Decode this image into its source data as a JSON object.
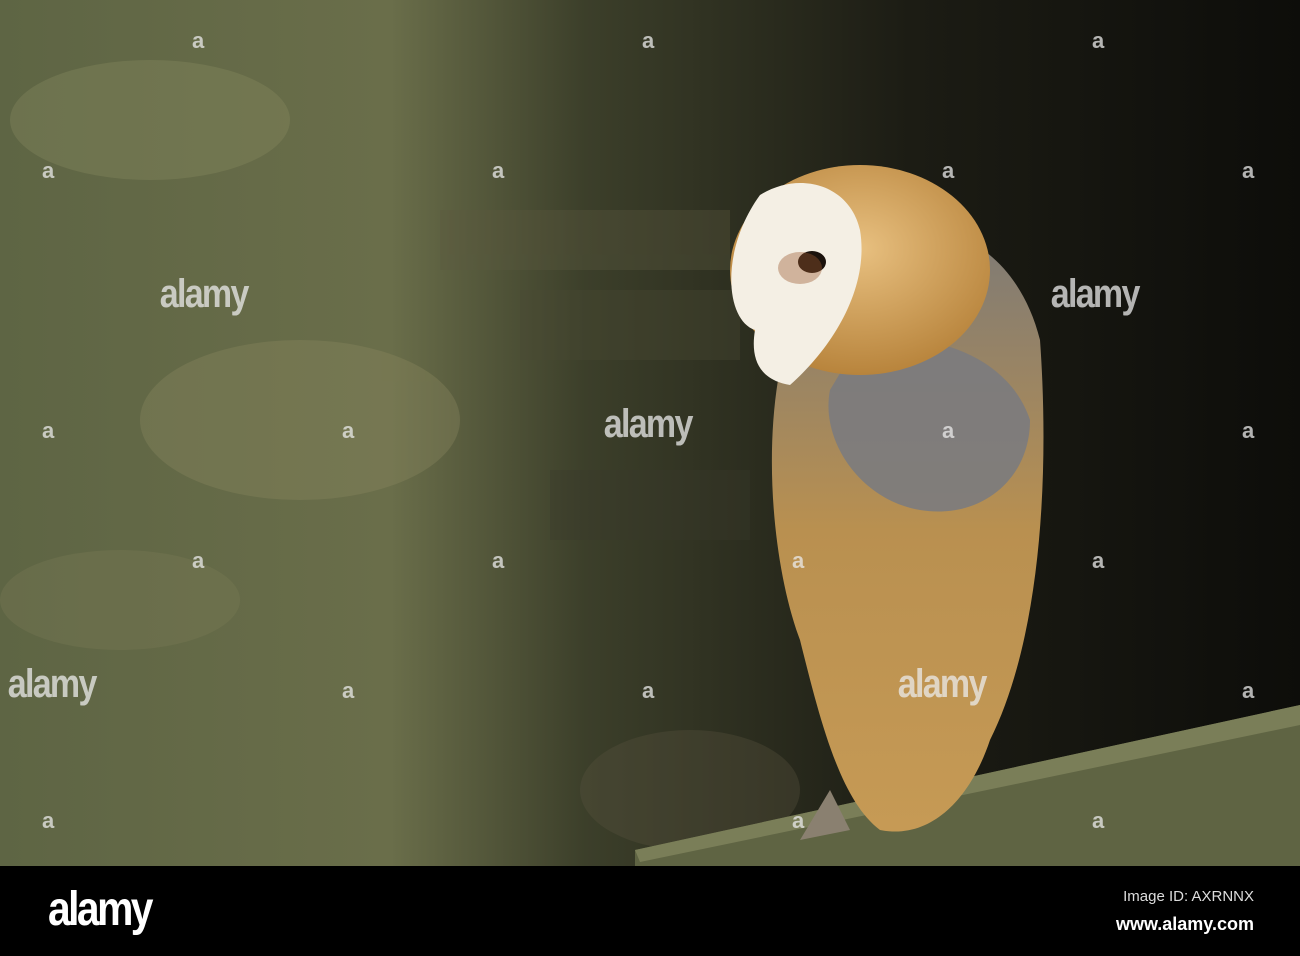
{
  "watermark": {
    "brand": "alamy",
    "small_mark": "a"
  },
  "footer": {
    "logo": "alamy",
    "image_id": "Image ID: AXRNNX",
    "url": "www.alamy.com"
  }
}
